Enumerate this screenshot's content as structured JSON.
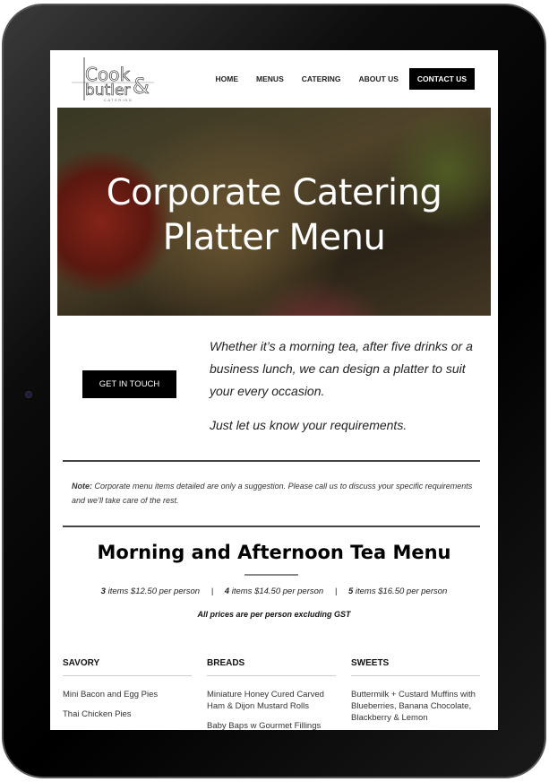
{
  "brand": {
    "logo_text": "Cook & Butler Catering",
    "colors": {
      "primary": "#000000",
      "bezel": "#0c0c0c"
    }
  },
  "nav": {
    "items": [
      "HOME",
      "MENUS",
      "CATERING",
      "ABOUT US"
    ],
    "cta": "CONTACT US"
  },
  "hero": {
    "title": "Corporate Catering Platter Menu"
  },
  "intro": {
    "button": "GET IN TOUCH",
    "paragraphs": [
      "Whether it’s a morning tea, after five drinks or a business lunch, we can design a platter to suit your every occasion.",
      "Just let us know your requirements."
    ]
  },
  "note": {
    "label": "Note:",
    "text": " Corporate menu items detailed are only a suggestion. Please call us to discuss your specific requirements and we’ll take care of the rest."
  },
  "menu": {
    "title": "Morning and Afternoon Tea Menu",
    "prices": [
      {
        "n": "3",
        "text": " items $12.50 per person"
      },
      {
        "n": "4",
        "text": " items $14.50 per person"
      },
      {
        "n": "5",
        "text": " items $16.50 per person"
      }
    ],
    "separator": "|",
    "gst": "All prices are per person excluding GST",
    "columns": [
      {
        "title": "SAVORY",
        "items": [
          "Mini Bacon and Egg Pies",
          "Thai Chicken Pies"
        ]
      },
      {
        "title": "BREADS",
        "items": [
          "Miniature Honey Cured Carved Ham & Dijon Mustard Rolls",
          "Baby Baps w Gourmet Fillings"
        ]
      },
      {
        "title": "SWEETS",
        "items": [
          "Buttermilk + Custard Muffins with Blueberries, Banana Chocolate, Blackberry & Lemon"
        ]
      }
    ]
  }
}
